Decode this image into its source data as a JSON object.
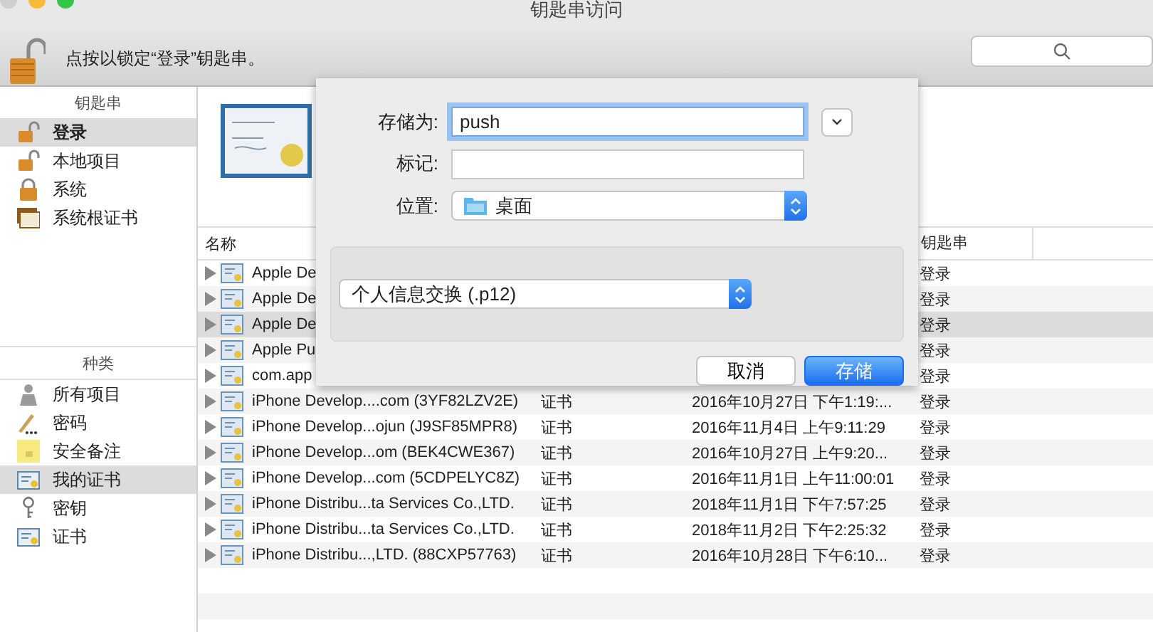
{
  "window": {
    "title": "钥匙串访问"
  },
  "toolbar": {
    "lock_message": "点按以锁定“登录”钥匙串。"
  },
  "sidebar": {
    "keychains_header": "钥匙串",
    "keychains": [
      {
        "label": "登录",
        "kind": "lock-open",
        "selected": true
      },
      {
        "label": "本地项目",
        "kind": "lock-open",
        "selected": false
      },
      {
        "label": "系统",
        "kind": "lock-closed",
        "selected": false
      },
      {
        "label": "系统根证书",
        "kind": "cert-stack",
        "selected": false
      }
    ],
    "categories_header": "种类",
    "categories": [
      {
        "label": "所有项目",
        "kind": "people",
        "selected": false
      },
      {
        "label": "密码",
        "kind": "pen",
        "selected": false
      },
      {
        "label": "安全备注",
        "kind": "note",
        "selected": false
      },
      {
        "label": "我的证书",
        "kind": "cert",
        "selected": true
      },
      {
        "label": "密钥",
        "kind": "key",
        "selected": false
      },
      {
        "label": "证书",
        "kind": "cert",
        "selected": false
      }
    ]
  },
  "table": {
    "columns": [
      "名称",
      "钥匙串"
    ],
    "rows": [
      {
        "name": "Apple De",
        "keychain": "登录",
        "selected": false
      },
      {
        "name": "Apple De",
        "keychain": "登录",
        "selected": false
      },
      {
        "name": "Apple De",
        "keychain": "登录",
        "selected": true
      },
      {
        "name": "Apple Pu",
        "keychain": "登录",
        "selected": false
      },
      {
        "name": "com.app",
        "keychain": "登录",
        "selected": false
      },
      {
        "name": "iPhone Develop....com (3YF82LZV2E)",
        "kind": "证书",
        "date": "2016年10月27日 下午1:19:...",
        "keychain": "登录",
        "selected": false
      },
      {
        "name": "iPhone Develop...ojun (J9SF85MPR8)",
        "kind": "证书",
        "date": "2016年11月4日 上午9:11:29",
        "keychain": "登录",
        "selected": false
      },
      {
        "name": "iPhone Develop...om (BEK4CWE367)",
        "kind": "证书",
        "date": "2016年10月27日 上午9:20...",
        "keychain": "登录",
        "selected": false
      },
      {
        "name": "iPhone Develop...com (5CDPELYC8Z)",
        "kind": "证书",
        "date": "2016年11月1日 上午11:00:01",
        "keychain": "登录",
        "selected": false
      },
      {
        "name": "iPhone Distribu...ta Services Co.,LTD.",
        "kind": "证书",
        "date": "2018年11月1日 下午7:57:25",
        "keychain": "登录",
        "selected": false
      },
      {
        "name": "iPhone Distribu...ta Services Co.,LTD.",
        "kind": "证书",
        "date": "2018年11月2日 下午2:25:32",
        "keychain": "登录",
        "selected": false
      },
      {
        "name": "iPhone Distribu...,LTD. (88CXP57763)",
        "kind": "证书",
        "date": "2016年10月28日 下午6:10...",
        "keychain": "登录",
        "selected": false
      }
    ]
  },
  "save_dialog": {
    "save_as_label": "存储为:",
    "save_as_value": "push",
    "tags_label": "标记:",
    "location_label": "位置:",
    "location_value": "桌面",
    "format_value": "个人信息交换 (.p12)",
    "cancel_button": "取消",
    "save_button": "存储"
  }
}
